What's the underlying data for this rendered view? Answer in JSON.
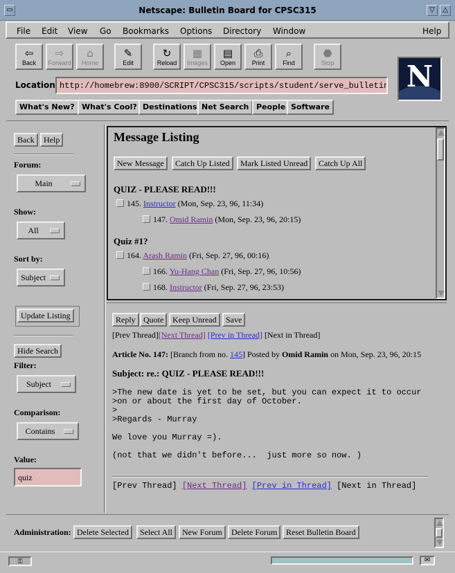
{
  "window": {
    "title": "Netscape: Bulletin Board for CPSC315",
    "ctrl_min": "▽",
    "ctrl_max": "△"
  },
  "menu": {
    "items": [
      "File",
      "Edit",
      "View",
      "Go",
      "Bookmarks",
      "Options",
      "Directory",
      "Window"
    ],
    "help": "Help"
  },
  "toolbar": {
    "buttons": [
      {
        "label": "Back",
        "icon": "back-arrow-icon",
        "glyph": "⇦"
      },
      {
        "label": "Forward",
        "icon": "forward-arrow-icon",
        "glyph": "⇨"
      },
      {
        "label": "Home",
        "icon": "home-icon",
        "glyph": "⌂"
      },
      {
        "label": "Edit",
        "icon": "pencil-icon",
        "glyph": "✎"
      },
      {
        "label": "Reload",
        "icon": "reload-icon",
        "glyph": "↻"
      },
      {
        "label": "Images",
        "icon": "images-icon",
        "glyph": "▦"
      },
      {
        "label": "Open",
        "icon": "open-icon",
        "glyph": "▤"
      },
      {
        "label": "Print",
        "icon": "printer-icon",
        "glyph": "⎙"
      },
      {
        "label": "Find",
        "icon": "binoculars-icon",
        "glyph": "⌕"
      },
      {
        "label": "Stop",
        "icon": "stop-icon",
        "glyph": "⬣"
      }
    ]
  },
  "logo": {
    "letter": "N"
  },
  "location": {
    "label": "Location:",
    "url": "http://homebrew:8900/SCRIPT/CPSC315/scripts/student/serve_bulletin"
  },
  "directory_buttons": [
    "What's New?",
    "What's Cool?",
    "Destinations",
    "Net Search",
    "People",
    "Software"
  ],
  "sidebar": {
    "back": "Back",
    "help": "Help",
    "forum_label": "Forum:",
    "forum_value": "Main",
    "show_label": "Show:",
    "show_value": "All",
    "sortby_label": "Sort by:",
    "sortby_value": "Subject",
    "update_listing": "Update Listing",
    "hide_search": "Hide Search",
    "filter_label": "Filter:",
    "filter_value": "Subject",
    "comparison_label": "Comparison:",
    "comparison_value": "Contains",
    "value_label": "Value:",
    "value_input": "quiz"
  },
  "listing": {
    "title": "Message Listing",
    "buttons": [
      "New Message",
      "Catch Up Listed",
      "Mark Listed Unread",
      "Catch Up All"
    ],
    "threads": [
      {
        "subject": "QUIZ - PLEASE READ!!!",
        "messages": [
          {
            "num": "145.",
            "author": "Instructor",
            "date": "(Mon, Sep. 23, 96, 11:34)",
            "indent": 0,
            "visited": false
          },
          {
            "num": "147.",
            "author": "Omid Ramin",
            "date": "(Mon, Sep. 23, 96, 20:15)",
            "indent": 1,
            "visited": true
          }
        ]
      },
      {
        "subject": "Quiz #1?",
        "messages": [
          {
            "num": "164.",
            "author": "Arash Ramin",
            "date": "(Fri, Sep. 27, 96, 00:16)",
            "indent": 0,
            "visited": true
          },
          {
            "num": "166.",
            "author": "Yu-Hang Chan",
            "date": "(Fri, Sep. 27, 96, 10:56)",
            "indent": 1,
            "visited": true
          },
          {
            "num": "168.",
            "author": "Instructor",
            "date": "(Fri, Sep. 27, 96, 23:53)",
            "indent": 1,
            "visited": true
          }
        ]
      }
    ]
  },
  "article": {
    "buttons": [
      "Reply",
      "Quote",
      "Keep Unread",
      "Save"
    ],
    "nav": {
      "prev_thread": "[Prev Thread]",
      "next_thread": "[Next Thread]",
      "prev_in_thread": "[Prev in Thread]",
      "next_in_thread": "[Next in Thread]"
    },
    "header": {
      "article_no": "Article No. 147:",
      "branch_pre": "[Branch from no.",
      "branch_num": "145",
      "branch_post": "] Posted by",
      "author": "Omid Ramin",
      "date": "on Mon, Sep. 23, 96, 20:15"
    },
    "subject": "Subject: re.: QUIZ - PLEASE READ!!!",
    "body": ">The new date is yet to be set, but you can expect it to occur\n>on or about the first day of October.\n>\n>Regards - Murray\n\nWe love you Murray =).\n\n(not that we didn't before...  just more so now. )"
  },
  "admin": {
    "label": "Administration:",
    "buttons": [
      "Delete Selected",
      "Select All",
      "New Forum",
      "Delete Forum",
      "Reset Bulletin Board"
    ]
  }
}
